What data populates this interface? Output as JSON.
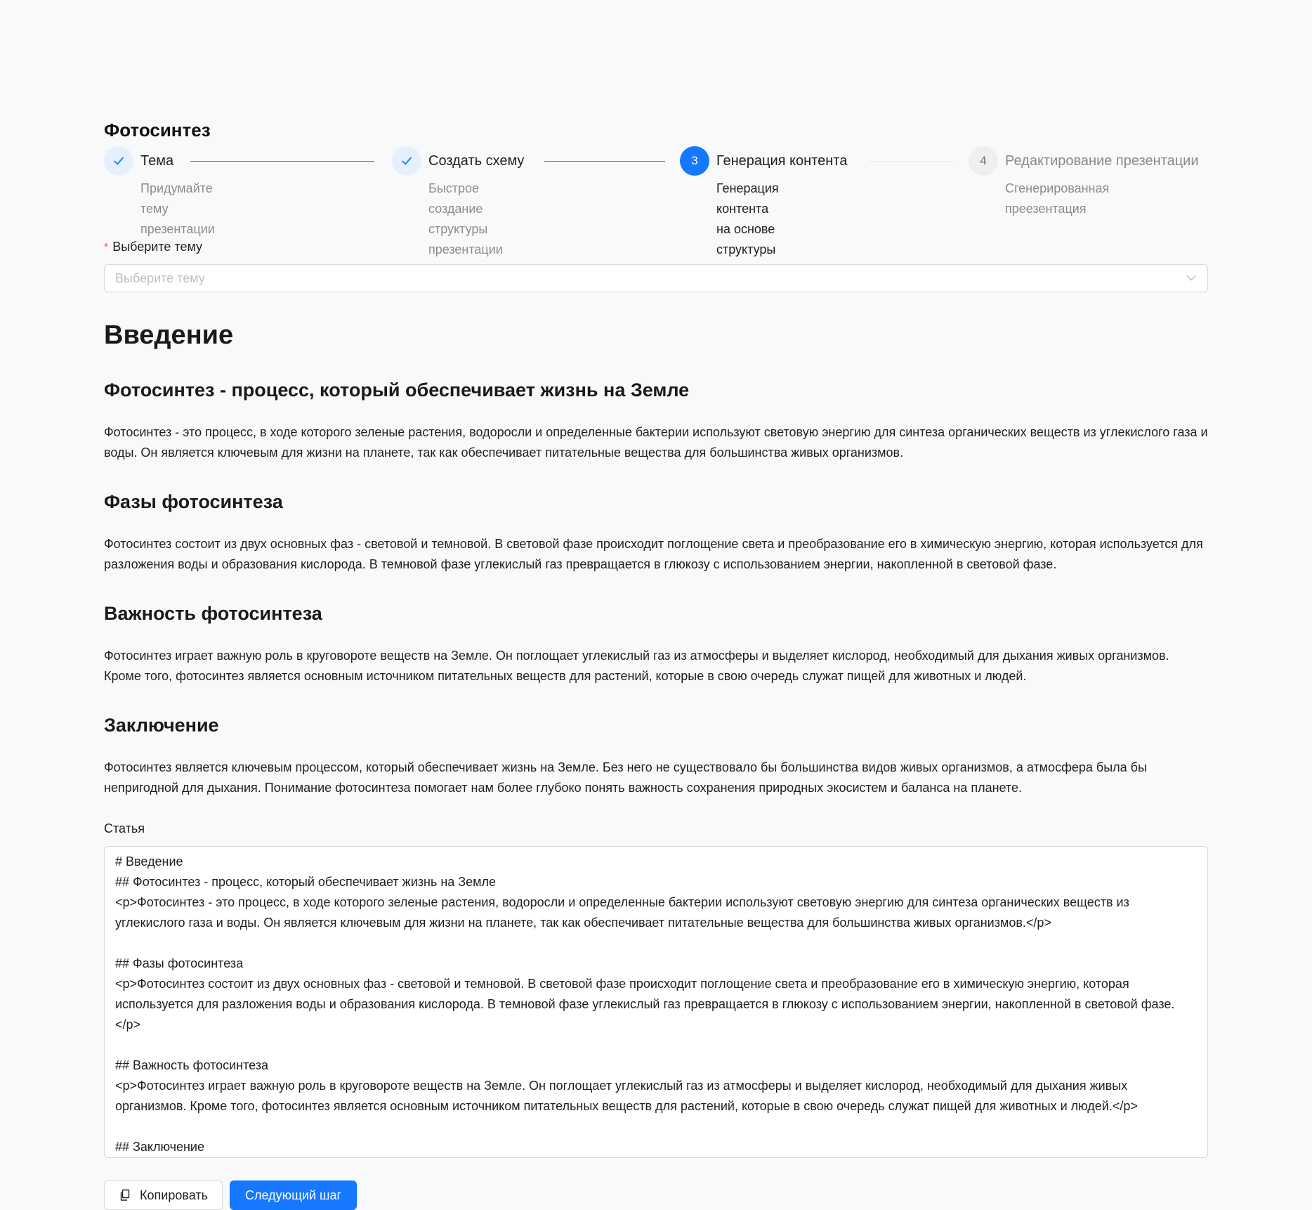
{
  "page": {
    "title": "Фотосинтез"
  },
  "steps": [
    {
      "status": "done",
      "icon": "check-icon",
      "title": "Тема",
      "desc_lines": [
        "Придумайте тему",
        "презентации"
      ]
    },
    {
      "status": "done",
      "icon": "check-icon",
      "title": "Создать схему",
      "desc_lines": [
        "Быстрое создание",
        "структуры",
        "презентации"
      ]
    },
    {
      "status": "active",
      "number": "3",
      "title": "Генерация контента",
      "desc_lines": [
        "Генерация контента",
        "на основе структуры"
      ]
    },
    {
      "status": "wait",
      "number": "4",
      "title": "Редактирование презентации",
      "desc_lines": [
        "Сгенерированная",
        "преезентация"
      ]
    }
  ],
  "theme_select": {
    "required_mark": "*",
    "label": "Выберите тему",
    "placeholder": "Выберите тему"
  },
  "article": {
    "h1": "Введение",
    "sections": [
      {
        "heading": "Фотосинтез - процесс, который обеспечивает жизнь на Земле",
        "text": "Фотосинтез - это процесс, в ходе которого зеленые растения, водоросли и определенные бактерии используют световую энергию для синтеза органических веществ из углекислого газа и воды. Он является ключевым для жизни на планете, так как обеспечивает питательные вещества для большинства живых организмов."
      },
      {
        "heading": "Фазы фотосинтеза",
        "text": "Фотосинтез состоит из двух основных фаз - световой и темновой. В световой фазе происходит поглощение света и преобразование его в химическую энергию, которая используется для разложения воды и образования кислорода. В темновой фазе углекислый газ превращается в глюкозу с использованием энергии, накопленной в световой фазе."
      },
      {
        "heading": "Важность фотосинтеза",
        "text": "Фотосинтез играет важную роль в круговороте веществ на Земле. Он поглощает углекислый газ из атмосферы и выделяет кислород, необходимый для дыхания живых организмов. Кроме того, фотосинтез является основным источником питательных веществ для растений, которые в свою очередь служат пищей для животных и людей."
      },
      {
        "heading": "Заключение",
        "text": "Фотосинтез является ключевым процессом, который обеспечивает жизнь на Земле. Без него не существовало бы большинства видов живых организмов, а атмосфера была бы непригодной для дыхания. Понимание фотосинтеза помогает нам более глубоко понять важность сохранения природных экосистем и баланса на планете."
      }
    ]
  },
  "editor": {
    "label": "Статья",
    "content": "# Введение\n## Фотосинтез - процесс, который обеспечивает жизнь на Земле\n<p>Фотосинтез - это процесс, в ходе которого зеленые растения, водоросли и определенные бактерии используют световую энергию для синтеза органических веществ из углекислого газа и воды. Он является ключевым для жизни на планете, так как обеспечивает питательные вещества для большинства живых организмов.</p>\n\n## Фазы фотосинтеза\n<p>Фотосинтез состоит из двух основных фаз - световой и темновой. В световой фазе происходит поглощение света и преобразование его в химическую энергию, которая используется для разложения воды и образования кислорода. В темновой фазе углекислый газ превращается в глюкозу с использованием энергии, накопленной в световой фазе.</p>\n\n## Важность фотосинтеза\n<p>Фотосинтез играет важную роль в круговороте веществ на Земле. Он поглощает углекислый газ из атмосферы и выделяет кислород, необходимый для дыхания живых организмов. Кроме того, фотосинтез является основным источником питательных веществ для растений, которые в свою очередь служат пищей для животных и людей.</p>\n\n## Заключение"
  },
  "actions": {
    "copy_label": "Копировать",
    "copy_icon": "copy-icon",
    "next_label": "Следующий шаг"
  },
  "colors": {
    "primary": "#1677ff",
    "required": "#ff4d4f",
    "background": "#f8f9fb"
  }
}
